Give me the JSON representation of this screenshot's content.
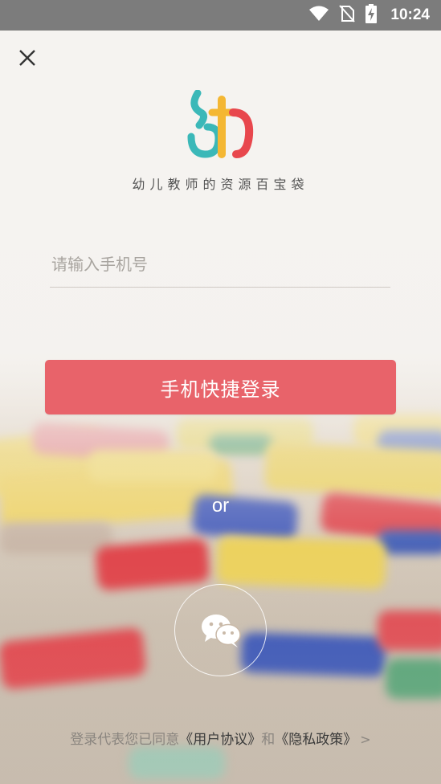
{
  "status_bar": {
    "time": "10:24",
    "icons": [
      "wifi-icon",
      "no-sim-icon",
      "battery-charging-icon"
    ]
  },
  "header": {
    "close_icon": "close-icon"
  },
  "logo": {
    "app_tagline": "幼儿教师的资源百宝袋"
  },
  "form": {
    "phone_placeholder": "请输入手机号",
    "phone_value": "",
    "login_button": "手机快捷登录"
  },
  "alt_login": {
    "or_text": "or",
    "wechat_icon": "wechat-icon"
  },
  "agreement": {
    "prefix": "登录代表您已同意",
    "user_agreement": "《用户协议》",
    "and": "和",
    "privacy_policy": "《隐私政策》",
    "chevron": ">"
  },
  "colors": {
    "accent": "#e8636a",
    "status_bar": "#7c7c7c",
    "logo_teal": "#3bb8b8",
    "logo_yellow": "#f4b733",
    "logo_red": "#e8474d"
  }
}
